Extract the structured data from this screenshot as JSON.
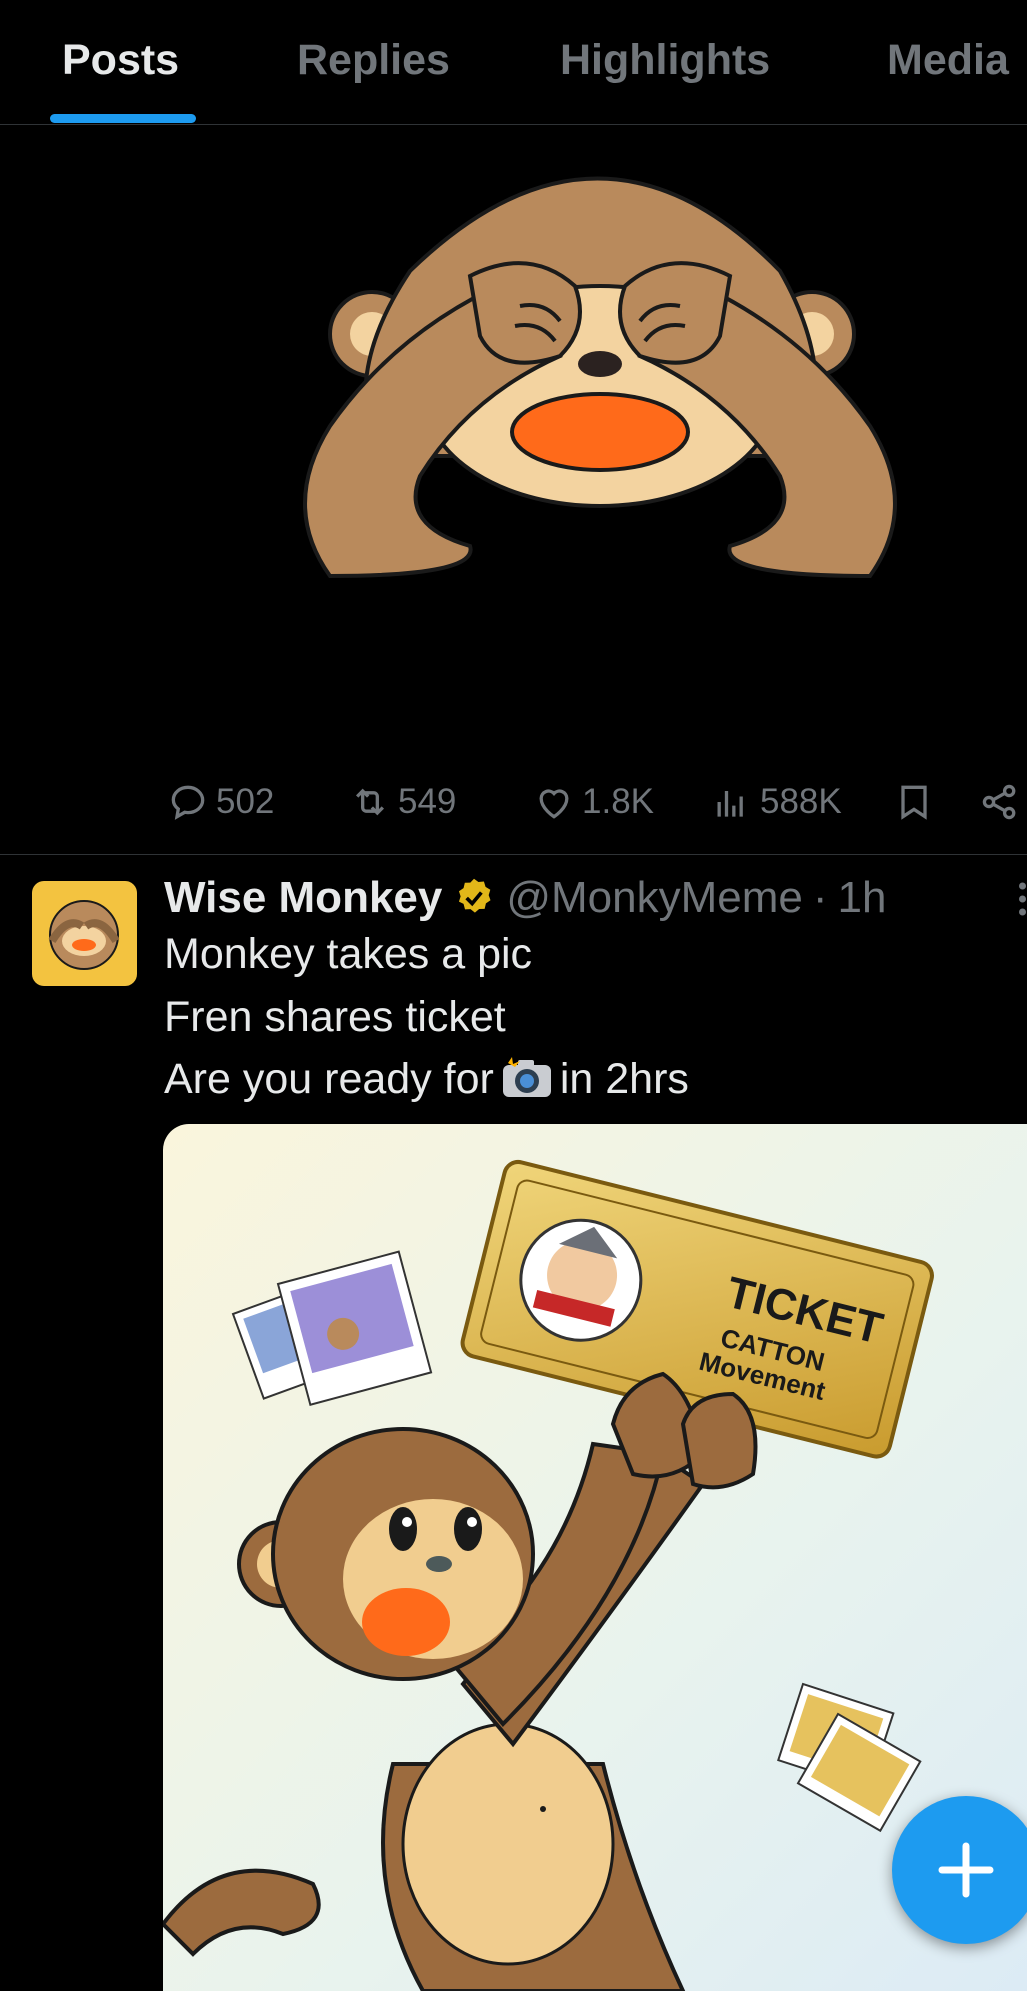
{
  "tabs": [
    {
      "label": "Posts",
      "active": true
    },
    {
      "label": "Replies",
      "active": false
    },
    {
      "label": "Highlights",
      "active": false
    },
    {
      "label": "Media",
      "active": false
    }
  ],
  "post1": {
    "stats": {
      "replies": "502",
      "reposts": "549",
      "likes": "1.8K",
      "views": "588K"
    }
  },
  "post2": {
    "author_name": "Wise Monkey",
    "handle": "@MonkyMeme",
    "separator": "·",
    "time": "1h",
    "lines": [
      "Monkey takes a pic",
      "Fren shares ticket",
      "Are you ready for",
      "in 2hrs"
    ],
    "image": {
      "ticket_title": "TICKET",
      "ticket_sub1": "CATTON",
      "ticket_sub2": "Movement"
    }
  },
  "fab": {
    "icon": "plus-icon"
  },
  "colors": {
    "accent": "#1d9bf0",
    "muted": "#71767b",
    "text": "#e7e9ea",
    "divider": "#2f3336",
    "verified": "#e2b719"
  }
}
